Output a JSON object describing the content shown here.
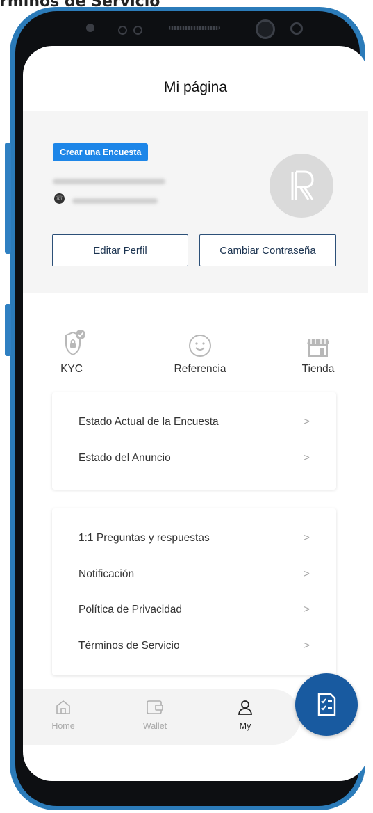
{
  "caption": "rminos de Servicio",
  "header": {
    "title": "Mi página"
  },
  "profile": {
    "survey_button": "Crear una Encuesta",
    "edit_profile": "Editar Perfil",
    "change_password": "Cambiar Contraseña"
  },
  "quick_links": [
    {
      "label": "KYC",
      "icon": "shield-check-icon"
    },
    {
      "label": "Referencia",
      "icon": "smiley-icon"
    },
    {
      "label": "Tienda",
      "icon": "store-icon"
    }
  ],
  "menu_group1": [
    {
      "label": "Estado Actual de la Encuesta"
    },
    {
      "label": "Estado del Anuncio"
    }
  ],
  "menu_group2": [
    {
      "label": "1:1 Preguntas y respuestas"
    },
    {
      "label": "Notificación"
    },
    {
      "label": "Política de Privacidad"
    },
    {
      "label": "Términos de Servicio"
    }
  ],
  "chevron": ">",
  "tabs": [
    {
      "label": "Home",
      "icon": "home-icon",
      "active": false
    },
    {
      "label": "Wallet",
      "icon": "wallet-icon",
      "active": false
    },
    {
      "label": "My",
      "icon": "user-icon",
      "active": true
    }
  ],
  "fab": {
    "icon": "checklist-icon"
  },
  "colors": {
    "accent": "#1d86e8",
    "fab": "#185aa0",
    "phone_frame": "#2b7bb9",
    "button_border": "#2c5078"
  }
}
